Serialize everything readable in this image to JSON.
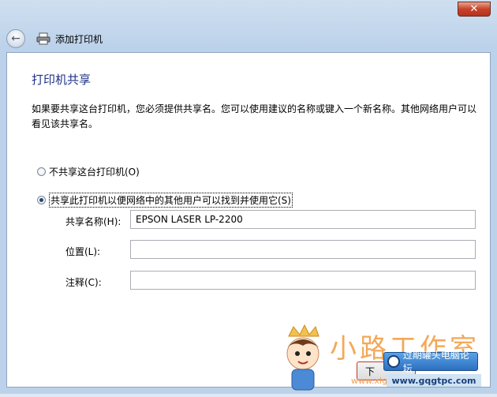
{
  "window": {
    "close_symbol": "✕"
  },
  "nav": {
    "back_symbol": "←",
    "title": "添加打印机"
  },
  "page": {
    "heading": "打印机共享",
    "description": "如果要共享这台打印机，您必须提供共享名。您可以使用建议的名称或键入一个新名称。其他网络用户可以看见该共享名。"
  },
  "options": {
    "no_share_label": "不共享这台打印机(O)",
    "share_label": "共享此打印机以便网络中的其他用户可以找到并使用它(S)"
  },
  "fields": {
    "share_name_label": "共享名称(H):",
    "share_name_value": "EPSON LASER LP-2200",
    "location_label": "位置(L):",
    "location_value": "",
    "comment_label": "注释(C):",
    "comment_value": ""
  },
  "buttons": {
    "next_label": "下"
  },
  "watermark": {
    "text": "小路工作室",
    "url": "www.xlgzs.com",
    "badge_text": "过期罐头电脑论坛",
    "badge_url": "www.gqgtpc.com"
  },
  "colors": {
    "heading": "#1e3287",
    "close_button": "#c6432a"
  }
}
